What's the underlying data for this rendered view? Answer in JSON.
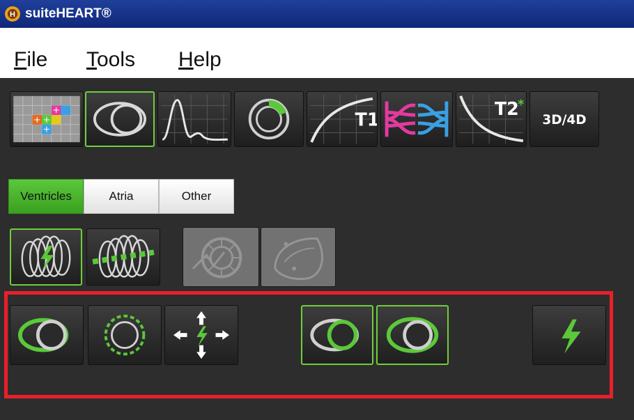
{
  "window": {
    "title": "suiteHEART®"
  },
  "menu": {
    "file_first": "F",
    "file_rest": "ile",
    "tools_first": "T",
    "tools_rest": "ools",
    "help_first": "H",
    "help_rest": "elp"
  },
  "toolbar": {
    "t1_label": "T1",
    "t2_label": "T2",
    "t2_star": "*",
    "threed_label": "3D/4D",
    "items": [
      "matrix-viewer",
      "function-analysis",
      "flow-analysis",
      "myocardial-evaluation",
      "t1-mapping",
      "shunt-analysis",
      "t2-star",
      "3d-4d-viewer"
    ]
  },
  "tabs": {
    "ventricles": "Ventricles",
    "atria": "Atria",
    "other": "Other",
    "active": "Ventricles"
  },
  "colors": {
    "accent": "#6fcf3a",
    "highlight": "#e8202a",
    "titlebar": "#1f3f9a",
    "workspace": "#2d2d2d"
  }
}
